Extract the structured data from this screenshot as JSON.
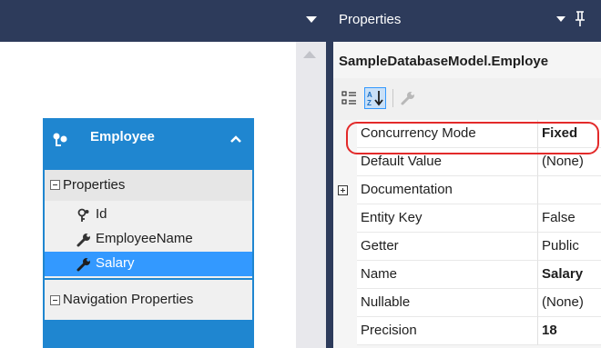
{
  "designer": {
    "entity": {
      "title": "Employee",
      "properties_section": "Properties",
      "properties": [
        {
          "label": "Id",
          "icon": "key-icon",
          "selected": false
        },
        {
          "label": "EmployeeName",
          "icon": "wrench-icon",
          "selected": false
        },
        {
          "label": "Salary",
          "icon": "wrench-icon",
          "selected": true
        }
      ],
      "navigation_section": "Navigation Properties"
    }
  },
  "properties_window": {
    "title": "Properties",
    "object_name": "SampleDatabaseModel.Employe",
    "toolbar": {
      "categorized_icon": "categorized-icon",
      "alphabetical_icon": "sort-az-icon",
      "property_pages_icon": "wrench-icon"
    },
    "rows": [
      {
        "name": "Concurrency Mode",
        "value": "Fixed",
        "bold_value": true,
        "highlighted": true,
        "expandable": false
      },
      {
        "name": "Default Value",
        "value": "(None)",
        "bold_value": false,
        "expandable": false
      },
      {
        "name": "Documentation",
        "value": "",
        "bold_value": false,
        "expandable": true
      },
      {
        "name": "Entity Key",
        "value": "False",
        "bold_value": false,
        "expandable": false
      },
      {
        "name": "Getter",
        "value": "Public",
        "bold_value": false,
        "expandable": false
      },
      {
        "name": "Name",
        "value": "Salary",
        "bold_value": true,
        "expandable": false
      },
      {
        "name": "Nullable",
        "value": "(None)",
        "bold_value": false,
        "expandable": false
      },
      {
        "name": "Precision",
        "value": "18",
        "bold_value": true,
        "expandable": false
      }
    ]
  },
  "colors": {
    "title_bar": "#2d3b5b",
    "entity_blue": "#1f86d0",
    "selection": "#3399ff",
    "highlight_red": "#e32a2a"
  }
}
